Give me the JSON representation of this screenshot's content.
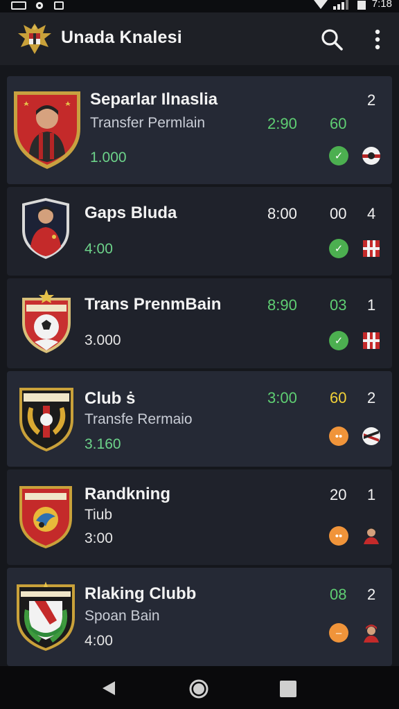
{
  "status_bar": {
    "time": "7:18"
  },
  "app_bar": {
    "title": "Unada Knalesi",
    "logo_icon": "garuda-emblem-icon",
    "search_icon": "search-icon",
    "menu_icon": "more-vert-icon"
  },
  "colors": {
    "background": "#15171c",
    "card": "#252935",
    "green": "#5fcf73",
    "orange": "#f0943a",
    "yellow": "#f3d238"
  },
  "items": [
    {
      "name": "Separlar Ilnaslia",
      "subtitle": "Transfer Permlain",
      "amount": "1.000",
      "time": "2:90",
      "score": "60",
      "rank": "2",
      "status": "check",
      "status_icon": "check-icon",
      "flag_icon": "club-crest-small-icon"
    },
    {
      "name": "Gaps Bluda",
      "subtitle": "",
      "amount": "4:00",
      "time": "8:00",
      "score": "00",
      "rank": "4",
      "status": "check",
      "status_icon": "check-icon",
      "flag_icon": "striped-flag-icon"
    },
    {
      "name": "Trans PrenmBain",
      "subtitle": "",
      "amount": "3.000",
      "time": "8:90",
      "score": "03",
      "rank": "1",
      "status": "check",
      "status_icon": "check-icon",
      "flag_icon": "striped-flag-icon"
    },
    {
      "name": "Club ṡ",
      "subtitle": "Transfe Rermaio",
      "amount": "3.160",
      "time": "3:00",
      "score": "60",
      "rank": "2",
      "status": "dots",
      "status_icon": "more-horiz-icon",
      "flag_icon": "club-crest-small-icon"
    },
    {
      "name": "Randkning",
      "subtitle": "Tiub",
      "amount": "3:00",
      "time": "",
      "score": "20",
      "rank": "1",
      "status": "dots",
      "status_icon": "more-horiz-icon",
      "flag_icon": "player-avatar-icon"
    },
    {
      "name": "Rlaking Clubb",
      "subtitle": "Spoan Bain",
      "amount": "4:00",
      "time": "",
      "score": "08",
      "rank": "2",
      "status": "dash",
      "status_icon": "minus-icon",
      "flag_icon": "player-avatar-icon"
    }
  ],
  "nav_bar": {
    "back_icon": "back-triangle-icon",
    "home_icon": "home-circle-icon",
    "recents_icon": "recents-square-icon"
  }
}
